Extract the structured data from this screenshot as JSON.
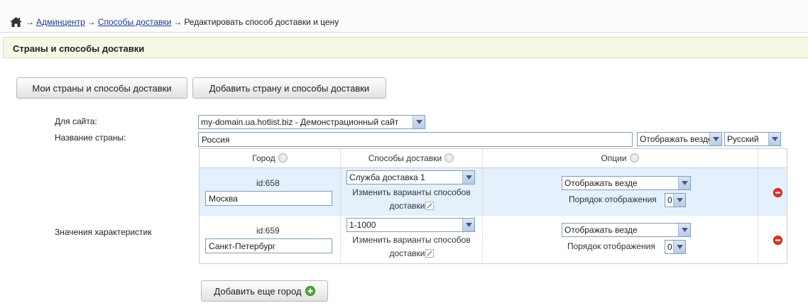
{
  "breadcrumb": {
    "items": [
      {
        "label": "Админцентр",
        "link": true
      },
      {
        "label": "Способы доставки",
        "link": true
      },
      {
        "label": "Редактировать способ доставки и цену",
        "link": false
      }
    ],
    "separator": "→"
  },
  "section": {
    "title": "Страны и способы доставки"
  },
  "tabs": {
    "my_label": "Мои страны и способы доставки",
    "add_label": "Добавить страну и способы доставки"
  },
  "form": {
    "site_label": "Для сайта:",
    "site_value": "my-domain.ua.hotlist.biz - Демонстрационный сайт",
    "country_label": "Название страны:",
    "country_value": "Россия",
    "display_value": "Отображать везде",
    "language_value": "Русский",
    "characteristics_label": "Значения характеристик"
  },
  "table": {
    "headers": {
      "city": "Город",
      "methods": "Способы доставки",
      "options": "Опции"
    },
    "rows": [
      {
        "id": "id:658",
        "city": "Москва",
        "method": "Служба доставка 1",
        "change_line1": "Изменить варианты способов",
        "change_line2": "доставки",
        "display": "Отображать везде",
        "order_label": "Порядок отображения",
        "order": "0"
      },
      {
        "id": "id:659",
        "city": "Санкт-Петербург",
        "method": "1-1000",
        "change_line1": "Изменить варианты способов",
        "change_line2": "доставки",
        "display": "Отображать везде",
        "order_label": "Порядок отображения",
        "order": "0"
      }
    ]
  },
  "add_city_label": "Добавить еще город",
  "colors": {
    "link": "#1a3c9a",
    "row_highlight": "#e4f0fc",
    "header_bg": "#f6f8e4",
    "delete": "#d9352c",
    "add": "#4bab3a"
  }
}
